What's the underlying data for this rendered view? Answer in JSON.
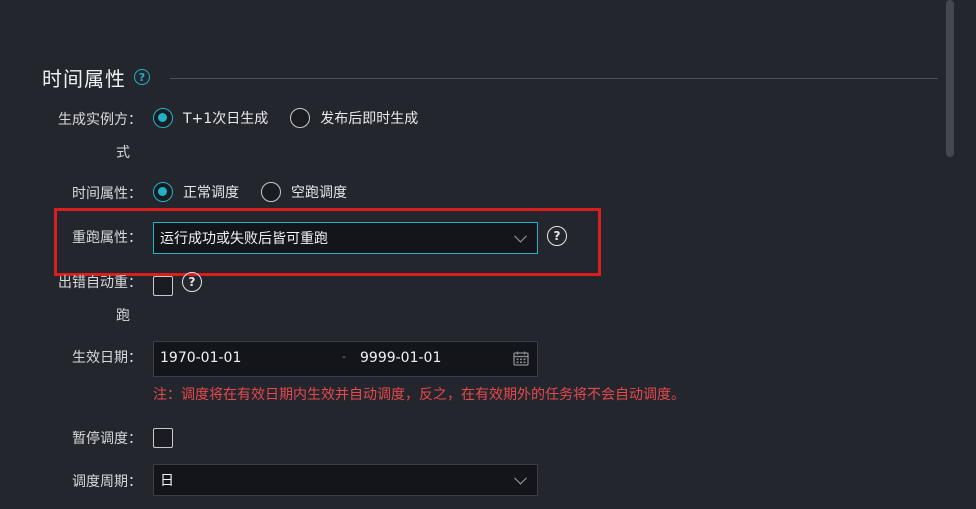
{
  "section": {
    "title": "时间属性",
    "help_glyph": "?"
  },
  "instance_mode": {
    "label_line1": "生成实例方：",
    "label_line2": "式",
    "options": [
      {
        "label": "T+1次日生成",
        "selected": true
      },
      {
        "label": "发布后即时生成",
        "selected": false
      }
    ]
  },
  "time_attr": {
    "label": "时间属性：",
    "options": [
      {
        "label": "正常调度",
        "selected": true
      },
      {
        "label": "空跑调度",
        "selected": false
      }
    ]
  },
  "rerun": {
    "label": "重跑属性：",
    "value": "运行成功或失败后皆可重跑",
    "help_glyph": "?"
  },
  "auto_rerun": {
    "label_line1": "出错自动重：",
    "label_line2": "跑",
    "checked": false,
    "help_glyph": "?"
  },
  "effective_date": {
    "label": "生效日期：",
    "start": "1970-01-01",
    "separator": "-",
    "end": "9999-01-01",
    "note": "注：调度将在有效日期内生效并自动调度，反之，在有效期外的任务将不会自动调度。"
  },
  "pause": {
    "label": "暂停调度：",
    "checked": false
  },
  "cycle": {
    "label": "调度周期：",
    "value": "日"
  },
  "colors": {
    "accent": "#1fb3c9",
    "highlight": "#d81e1e",
    "note": "#e5484d",
    "background": "#24262d"
  }
}
